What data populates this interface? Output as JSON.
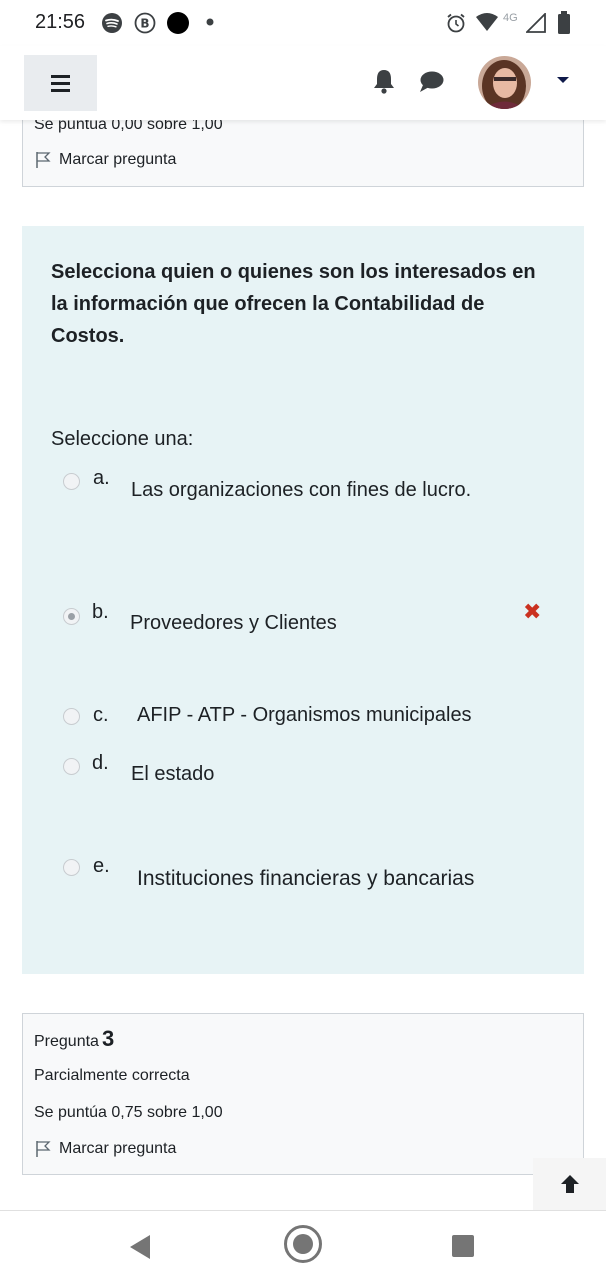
{
  "status_bar": {
    "time": "21:56",
    "network": "4G",
    "left_icons": [
      "spotify-icon",
      "b-circle-icon",
      "black-dot-icon",
      "small-dot-icon"
    ],
    "right_icons": [
      "alarm-icon",
      "wifi-icon",
      "signal-icon",
      "battery-icon"
    ]
  },
  "navbar": {
    "icons": [
      "hamburger-menu-icon",
      "bell-icon",
      "chat-icon",
      "user-avatar",
      "caret-down-icon"
    ]
  },
  "previous_question": {
    "score": "Se puntúa 0,00 sobre 1,00",
    "flag_label": "Marcar pregunta"
  },
  "question": {
    "text": "Selecciona quien o quienes son los interesados en la información que ofrecen la Contabilidad de Costos.",
    "prompt": "Seleccione una:",
    "options": [
      {
        "letter": "a.",
        "text": "Las organizaciones con fines de lucro.",
        "selected": false
      },
      {
        "letter": "b.",
        "text": "Proveedores y Clientes",
        "selected": true,
        "mark": "incorrect"
      },
      {
        "letter": "c.",
        "text": "AFIP - ATP - Organismos municipales",
        "selected": false
      },
      {
        "letter": "d.",
        "text": "El estado",
        "selected": false
      },
      {
        "letter": "e.",
        "text": "Instituciones financieras y bancarias",
        "selected": false
      }
    ],
    "wrong_mark": "✖"
  },
  "next_question": {
    "label": "Pregunta",
    "number": "3",
    "state": "Parcialmente correcta",
    "score": "Se puntúa 0,75 sobre 1,00",
    "flag_label": "Marcar pregunta"
  },
  "colors": {
    "question_bg": "#e7f3f5",
    "incorrect": "#ca3120",
    "info_bg": "#f8f9fa"
  }
}
